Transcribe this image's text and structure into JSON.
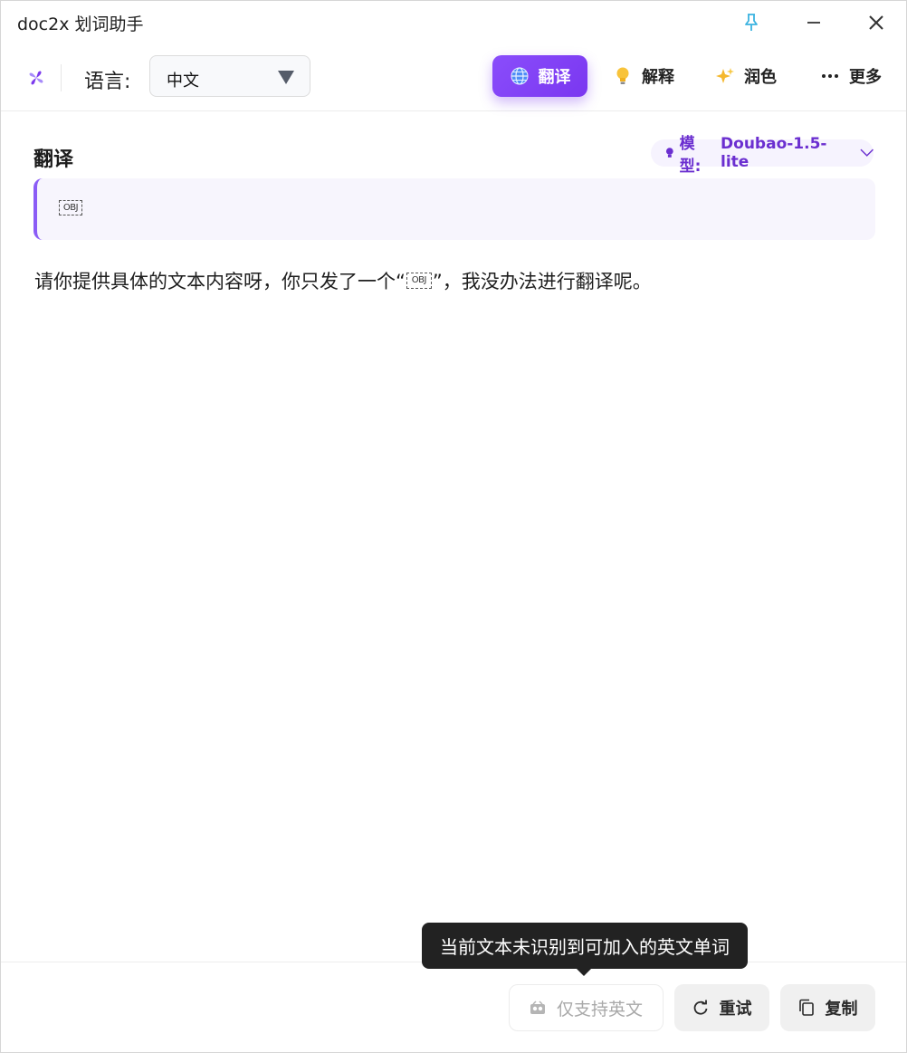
{
  "window": {
    "title": "doc2x 划词助手"
  },
  "toolbar": {
    "language_label": "语言:",
    "language_value": "中文",
    "tabs": [
      {
        "id": "translate",
        "label": "翻译",
        "icon": "globe-icon",
        "active": true
      },
      {
        "id": "explain",
        "label": "解释",
        "icon": "lightbulb-icon",
        "active": false
      },
      {
        "id": "polish",
        "label": "润色",
        "icon": "sparkles-icon",
        "active": false
      },
      {
        "id": "more",
        "label": "更多",
        "icon": "ellipsis-icon",
        "active": false
      }
    ]
  },
  "content": {
    "section_title": "翻译",
    "model_label": "模型:",
    "model_value": "Doubao-1.5-lite",
    "source_text": "OBJ",
    "result_before": "请你提供具体的文本内容呀，你只发了一个“",
    "result_obj": "OBJ",
    "result_after": "”，我没办法进行翻译呢。"
  },
  "footer": {
    "english_only_label": "仅支持英文",
    "retry_label": "重试",
    "copy_label": "复制",
    "tooltip": "当前文本未识别到可加入的英文单词"
  },
  "colors": {
    "accent": "#7c3aed",
    "accent_light": "#f6f3fe",
    "tooltip_bg": "#222222",
    "pin": "#3bb3e0"
  }
}
